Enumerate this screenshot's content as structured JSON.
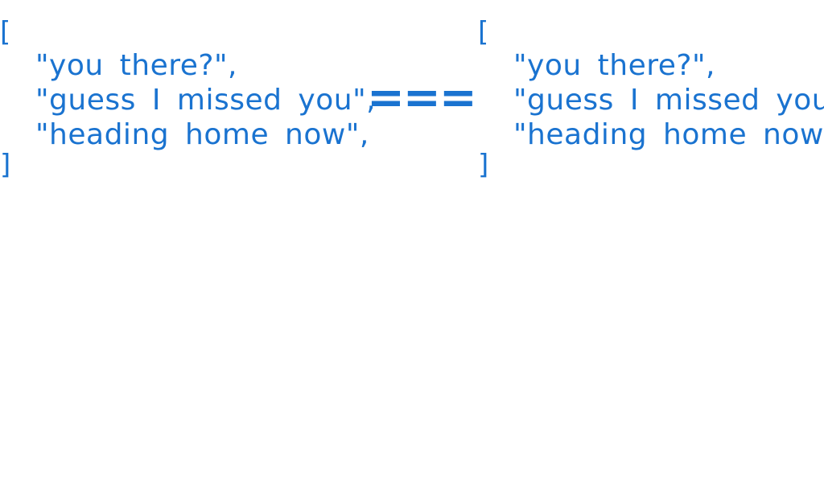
{
  "left_array": {
    "open_bracket": "[",
    "items": [
      "\"you there?\",",
      "\"guess I missed you\",",
      "\"heading home now\","
    ],
    "close_bracket": "]"
  },
  "operator": "===",
  "right_array": {
    "open_bracket": "[",
    "items": [
      "\"you there?\",",
      "\"guess I missed you\",",
      "\"heading home now\","
    ],
    "close_bracket": "]"
  },
  "colors": {
    "ink": "#1a73d0",
    "background": "#ffffff"
  }
}
